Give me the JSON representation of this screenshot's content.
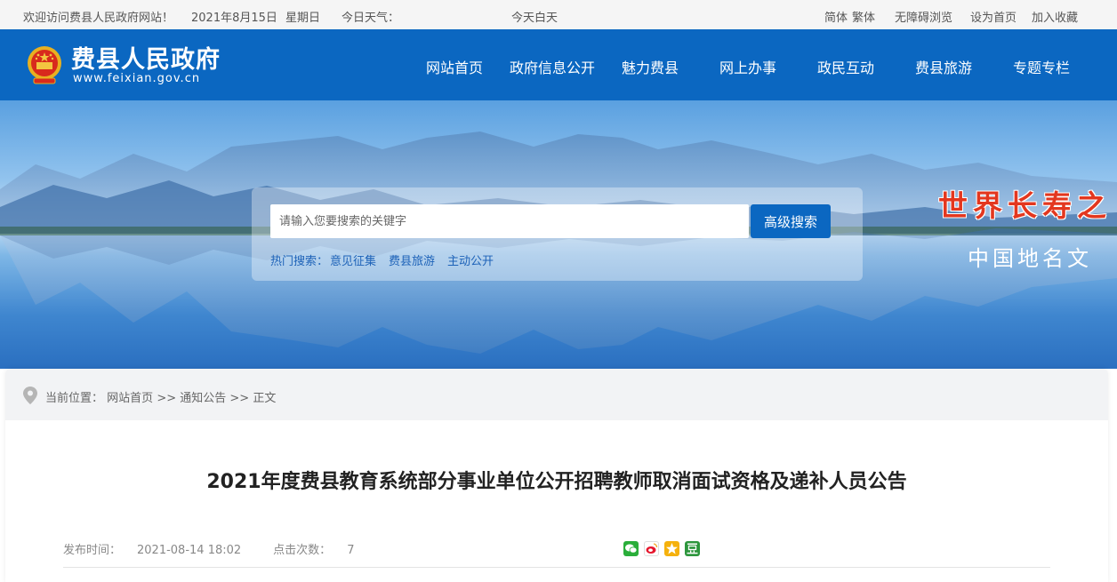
{
  "topbar": {
    "welcome": "欢迎访问费县人民政府网站！",
    "date": "2021年8月15日",
    "weekday": "星期日",
    "weather_label": "今日天气：",
    "weather_value": "今天白天",
    "simplified": "简体",
    "traditional": "繁体",
    "accessible": "无障碍浏览",
    "set_home": "设为首页",
    "bookmark": "加入收藏"
  },
  "header": {
    "site_name": "费县人民政府",
    "site_url": "www.feixian.gov.cn",
    "nav": [
      "网站首页",
      "政府信息公开",
      "魅力费县",
      "网上办事",
      "政民互动",
      "费县旅游",
      "专题专栏"
    ],
    "bg_color": "#0b67c1"
  },
  "banner": {
    "search_placeholder": "请输入您要搜索的关键字",
    "search_button": "高级搜索",
    "hot_label": "热门搜索：",
    "hot_items": [
      "意见征集",
      "费县旅游",
      "主动公开"
    ],
    "slogan_main": "世界长寿之",
    "slogan_sub": "中国地名文"
  },
  "breadcrumb": {
    "label": "当前位置：",
    "items": [
      "网站首页",
      "通知公告",
      "正文"
    ],
    "separator": ">>"
  },
  "article": {
    "title": "2021年度费县教育系统部分事业单位公开招聘教师取消面试资格及递补人员公告",
    "publish_label": "发布时间：",
    "publish_time": "2021-08-14 18:02",
    "clicks_label": "点击次数：",
    "clicks": "7"
  },
  "share_icons": [
    {
      "name": "wechat-icon",
      "color": "#2aae3a"
    },
    {
      "name": "weibo-icon",
      "color": "#e6162d"
    },
    {
      "name": "qzone-icon",
      "color": "#f5b10d"
    },
    {
      "name": "douban-icon",
      "color": "#2d963d"
    }
  ]
}
